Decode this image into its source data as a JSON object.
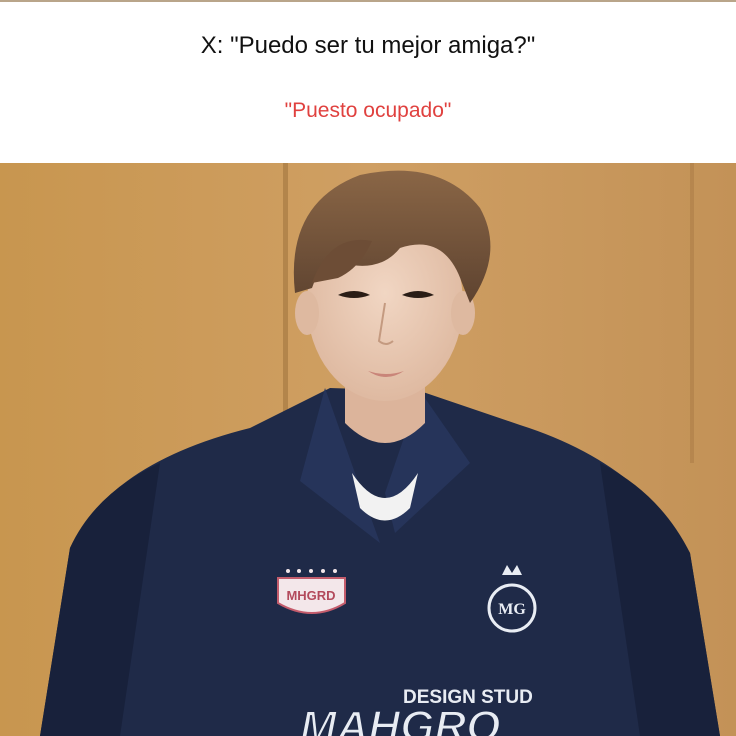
{
  "caption": {
    "question": "X: \"Puedo ser tu mejor amiga?\"",
    "reply": "\"Puesto ocupado\""
  },
  "photo": {
    "shirt_text_1": "DESIGN STUD",
    "shirt_text_2": "MAHGRO",
    "patch_text": "MHGRD",
    "colors": {
      "wall": "#c79a5f",
      "sweater": "#1f2a48",
      "hair": "#7a5a3e",
      "skin": "#e8cbb6",
      "caption_reply": "#e0413f"
    }
  }
}
